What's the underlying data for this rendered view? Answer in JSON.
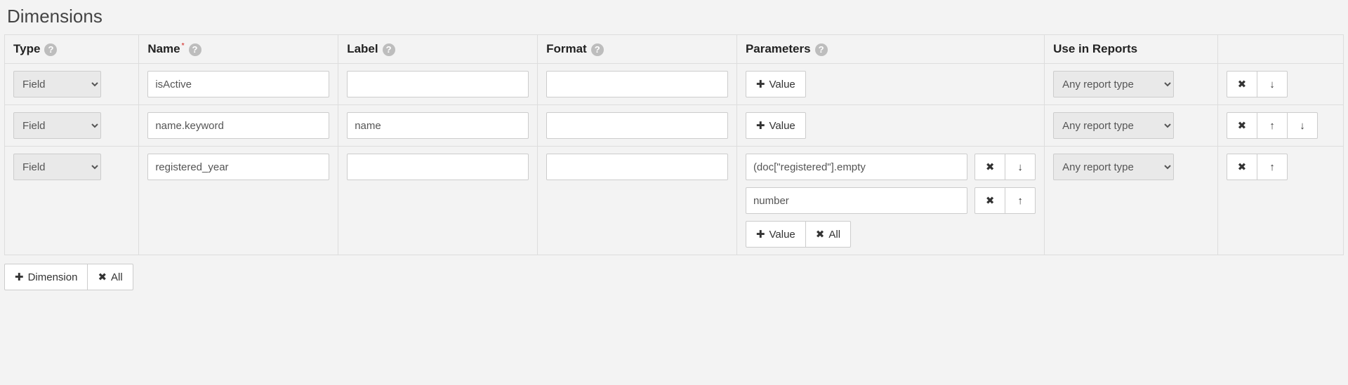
{
  "title": "Dimensions",
  "headers": {
    "type": "Type",
    "name": "Name",
    "label": "Label",
    "format": "Format",
    "parameters": "Parameters",
    "reports": "Use in Reports"
  },
  "typeOptions": [
    "Field"
  ],
  "reportOptions": [
    "Any report type"
  ],
  "buttons": {
    "addValue": "Value",
    "clearAll": "All",
    "addDimension": "Dimension"
  },
  "rows": [
    {
      "type": "Field",
      "name": "isActive",
      "label": "",
      "format": "",
      "reports": "Any report type",
      "params": [],
      "paramAddShown": true,
      "showUp": false,
      "showDown": true
    },
    {
      "type": "Field",
      "name": "name.keyword",
      "label": "name",
      "format": "",
      "reports": "Any report type",
      "params": [],
      "paramAddShown": true,
      "showUp": true,
      "showDown": true
    },
    {
      "type": "Field",
      "name": "registered_year",
      "label": "",
      "format": "",
      "reports": "Any report type",
      "params": [
        {
          "value": "(doc[\"registered\"].empty ",
          "showUp": false,
          "showDown": true
        },
        {
          "value": "number",
          "showUp": true,
          "showDown": false
        }
      ],
      "paramAddShown": true,
      "showUp": true,
      "showDown": false
    }
  ]
}
